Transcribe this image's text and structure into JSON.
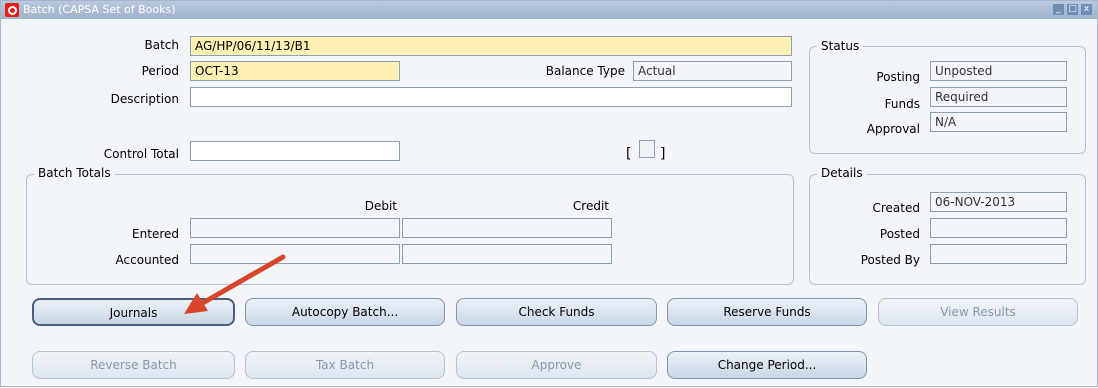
{
  "window": {
    "title": "Batch (CAPSA Set of Books)",
    "controls": {
      "minimize": "_",
      "maximize": "□",
      "close": "x"
    }
  },
  "form": {
    "batch_label": "Batch",
    "batch_value": "AG/HP/06/11/13/B1",
    "period_label": "Period",
    "period_value": "OCT-13",
    "balance_type_label": "Balance Type",
    "balance_type_value": "Actual",
    "description_label": "Description",
    "description_value": "",
    "control_total_label": "Control Total",
    "control_total_value": "",
    "bracket_open": "[",
    "bracket_close": "]"
  },
  "status": {
    "title": "Status",
    "posting_label": "Posting",
    "posting_value": "Unposted",
    "funds_label": "Funds",
    "funds_value": "Required",
    "approval_label": "Approval",
    "approval_value": "N/A"
  },
  "batch_totals": {
    "title": "Batch Totals",
    "debit_header": "Debit",
    "credit_header": "Credit",
    "entered_label": "Entered",
    "accounted_label": "Accounted"
  },
  "details": {
    "title": "Details",
    "created_label": "Created",
    "created_value": "06-NOV-2013",
    "posted_label": "Posted",
    "posted_value": "",
    "posted_by_label": "Posted By",
    "posted_by_value": ""
  },
  "buttons": {
    "journals": "Journals",
    "autocopy": "Autocopy Batch...",
    "check_funds": "Check Funds",
    "reserve_funds": "Reserve Funds",
    "view_results": "View Results",
    "reverse_batch": "Reverse Batch",
    "tax_batch": "Tax Batch",
    "approve": "Approve",
    "change_period": "Change Period..."
  },
  "colors": {
    "required_field": "#fcf0b3",
    "annotation_arrow": "#d9452b"
  }
}
